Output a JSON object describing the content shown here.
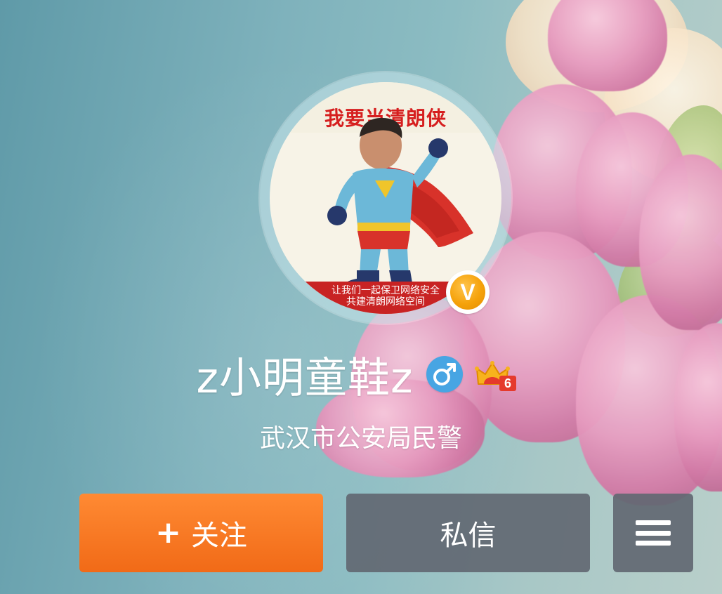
{
  "profile": {
    "username": "z小明童鞋z",
    "bio": "武汉市公安局民警",
    "verified_badge_letter": "V",
    "gender_icon": "male-symbol-icon",
    "vip_level": "6",
    "vip_icon": "crown-vip-icon"
  },
  "avatar": {
    "caption_top": "我要当清朗侠",
    "caption_bottom": "让我们一起保卫网络安全\n共建清朗网络空间"
  },
  "actions": {
    "follow_icon": "+",
    "follow_label": "关注",
    "message_label": "私信",
    "more_icon": "menu-icon"
  },
  "colors": {
    "follow_button": "#f27220",
    "secondary_button": "#626872",
    "verified_badge": "#f5a20b",
    "gender_icon_bg": "#47a5e3"
  }
}
